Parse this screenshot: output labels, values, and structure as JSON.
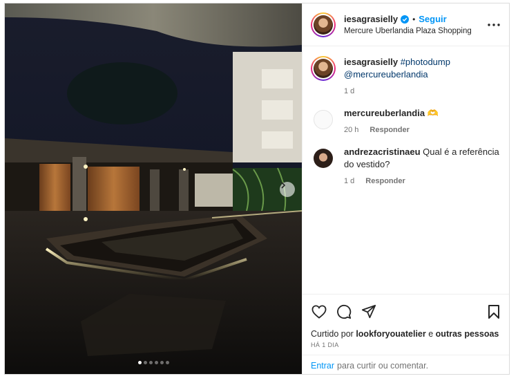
{
  "post": {
    "username": "iesagrasielly",
    "follow_label": "Seguir",
    "separator": "•",
    "location": "Mercure Uberlandia Plaza Shopping",
    "carousel_count": 6,
    "carousel_active": 0
  },
  "comments": [
    {
      "user": "iesagrasielly",
      "hashtag": "#photodump",
      "mention": "@mercureuberlandia",
      "trailing": "⁣⁣",
      "time": "1 d",
      "reply_label": ""
    },
    {
      "user": "mercureuberlandia",
      "text": "🫶",
      "time": "20 h",
      "reply_label": "Responder"
    },
    {
      "user": "andrezacristinaeu",
      "text": "Qual é a referência do vestido?",
      "time": "1 d",
      "reply_label": "Responder"
    }
  ],
  "likes": {
    "prefix": "Curtido por",
    "user": "lookforyouatelier",
    "conj": "e",
    "others": "outras pessoas"
  },
  "timestamp": "HÁ 1 DIA",
  "login": {
    "link": "Entrar",
    "text": "para curtir ou comentar."
  },
  "icons": {
    "like": "heart-icon",
    "comment": "comment-bubble-icon",
    "share": "paper-plane-icon",
    "save": "bookmark-icon",
    "more": "more-horizontal-icon",
    "verified": "verified-badge-icon",
    "next": "chevron-right-icon"
  },
  "colors": {
    "link_blue": "#0095f6",
    "mention_blue": "#00376b",
    "muted": "#737373",
    "text": "#262626"
  }
}
